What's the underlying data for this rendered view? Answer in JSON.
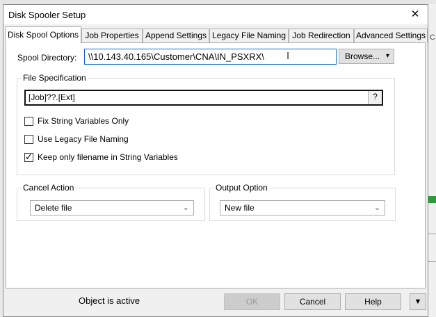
{
  "window": {
    "title": "Disk Spooler Setup",
    "close_glyph": "✕"
  },
  "background": {
    "edge_text": "C"
  },
  "tabs": [
    {
      "label": "Disk Spool Options"
    },
    {
      "label": "Job Properties"
    },
    {
      "label": "Append Settings"
    },
    {
      "label": "Legacy File Naming"
    },
    {
      "label": "Job Redirection"
    },
    {
      "label": "Advanced Settings"
    }
  ],
  "spool": {
    "label": "Spool Directory:",
    "value": "\\\\10.143.40.165\\Customer\\CNA\\IN_PSXRX\\",
    "browse_label": "Browse...",
    "browse_arrow": "▾",
    "cursor_glyph": "I"
  },
  "file_spec": {
    "group_title": "File Specification",
    "value": "[Job]??.[Ext]",
    "help_label": "?",
    "options": [
      {
        "label": "Fix String Variables Only",
        "checked": false
      },
      {
        "label": "Use Legacy File Naming",
        "checked": false
      },
      {
        "label": "Keep only filename in String Variables",
        "checked": true
      }
    ],
    "check_glyph": "✓"
  },
  "cancel_action": {
    "group_title": "Cancel Action",
    "selected": "Delete file",
    "chevron": "⌄"
  },
  "output_option": {
    "group_title": "Output Option",
    "selected": "New file",
    "chevron": "⌄"
  },
  "footer": {
    "status": "Object is active",
    "ok_label": "OK",
    "cancel_label": "Cancel",
    "help_label": "Help",
    "menu_arrow": "▼"
  }
}
